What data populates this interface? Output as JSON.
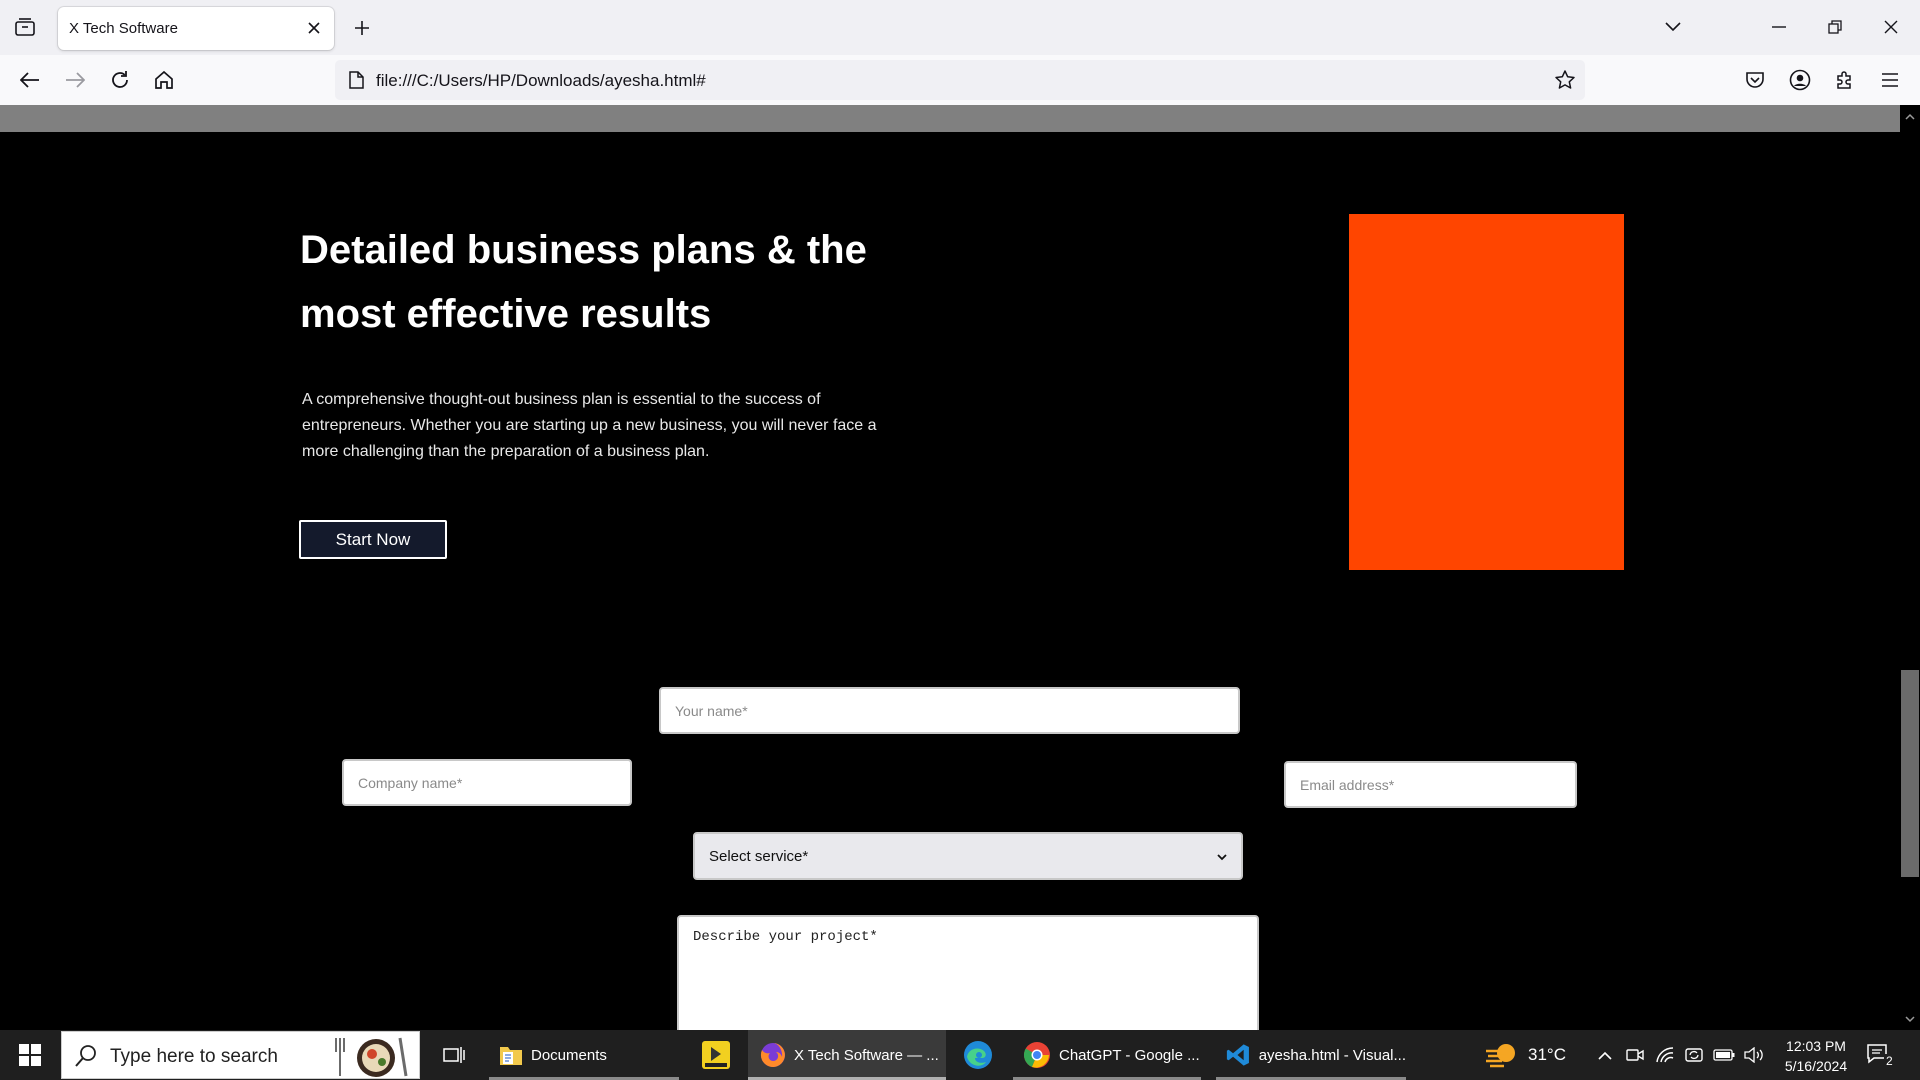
{
  "browser": {
    "tab_title": "X Tech Software",
    "url": "file:///C:/Users/HP/Downloads/ayesha.html#"
  },
  "hero": {
    "title": "Detailed business plans & the most effective results",
    "description": "A comprehensive thought-out business plan is essential to the success of entrepreneurs. Whether you are starting up a new business, you will never face a more challenging than the preparation of a business plan.",
    "cta_label": "Start Now",
    "accent_color": "#ff4500"
  },
  "form": {
    "name_placeholder": "Your name*",
    "company_placeholder": "Company name*",
    "email_placeholder": "Email address*",
    "service_selected": "Select service*",
    "project_placeholder": "Describe your project*"
  },
  "taskbar": {
    "search_placeholder": "Type here to search",
    "items": [
      {
        "label": "Documents"
      },
      {
        "label": "X Tech Software — ..."
      },
      {
        "label": "ChatGPT - Google ..."
      },
      {
        "label": "ayesha.html - Visual..."
      }
    ],
    "weather": "31°C",
    "time": "12:03 PM",
    "date": "5/16/2024",
    "notifications": "2"
  }
}
